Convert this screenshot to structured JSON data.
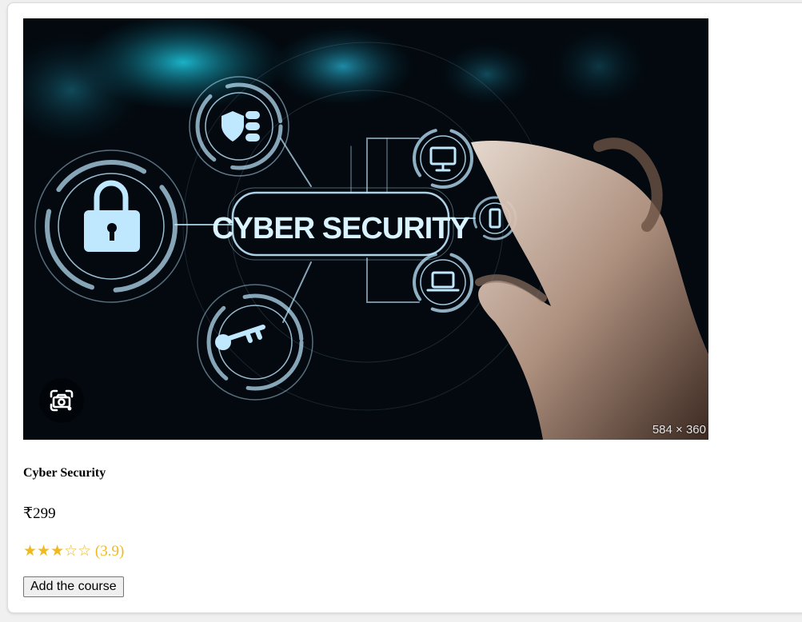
{
  "course": {
    "image": {
      "banner_text": "CYBER SECURITY",
      "dimensions_label": "584 × 360",
      "lens_icon": "visual-search-icon"
    },
    "title": "Cyber Security",
    "price": "₹299",
    "rating": {
      "value": 3.9,
      "stars_text": "★★★☆☆",
      "value_text": "(3.9)"
    },
    "add_button_label": "Add the course"
  },
  "colors": {
    "star": "#f0b91f",
    "banner_background": "#03090f",
    "hologram": "#bfe8ff"
  }
}
